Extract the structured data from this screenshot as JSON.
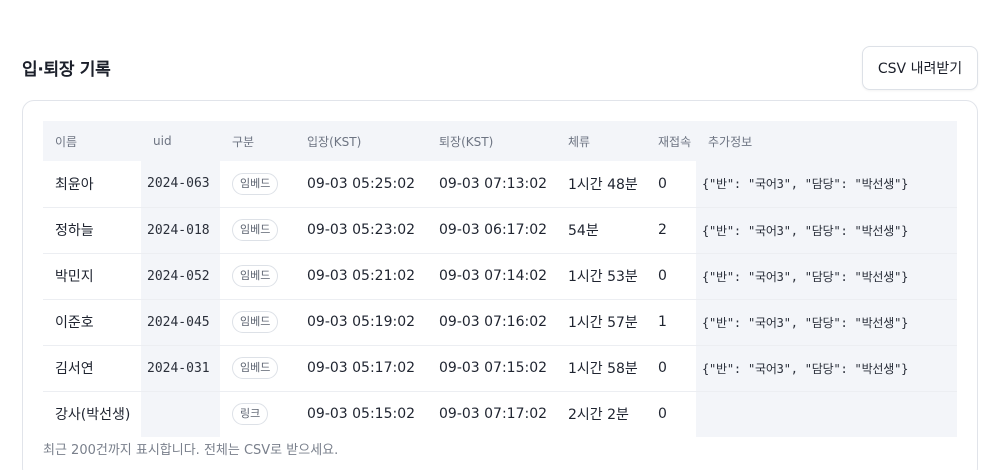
{
  "header": {
    "title": "입·퇴장 기록",
    "csv_button_label": "CSV 내려받기"
  },
  "table": {
    "columns": [
      "이름",
      "uid",
      "구분",
      "입장(KST)",
      "퇴장(KST)",
      "체류",
      "재접속",
      "추가정보"
    ],
    "rows": [
      {
        "name": "최윤아",
        "uid": "2024-063",
        "type": "임베드",
        "enter": "09-03 05:25:02",
        "exit": "09-03 07:13:02",
        "stay": "1시간 48분",
        "reconnect": "0",
        "extra": "{\"반\": \"국어3\", \"담당\": \"박선생\"}"
      },
      {
        "name": "정하늘",
        "uid": "2024-018",
        "type": "임베드",
        "enter": "09-03 05:23:02",
        "exit": "09-03 06:17:02",
        "stay": "54분",
        "reconnect": "2",
        "extra": "{\"반\": \"국어3\", \"담당\": \"박선생\"}"
      },
      {
        "name": "박민지",
        "uid": "2024-052",
        "type": "임베드",
        "enter": "09-03 05:21:02",
        "exit": "09-03 07:14:02",
        "stay": "1시간 53분",
        "reconnect": "0",
        "extra": "{\"반\": \"국어3\", \"담당\": \"박선생\"}"
      },
      {
        "name": "이준호",
        "uid": "2024-045",
        "type": "임베드",
        "enter": "09-03 05:19:02",
        "exit": "09-03 07:16:02",
        "stay": "1시간 57분",
        "reconnect": "1",
        "extra": "{\"반\": \"국어3\", \"담당\": \"박선생\"}"
      },
      {
        "name": "김서연",
        "uid": "2024-031",
        "type": "임베드",
        "enter": "09-03 05:17:02",
        "exit": "09-03 07:15:02",
        "stay": "1시간 58분",
        "reconnect": "0",
        "extra": "{\"반\": \"국어3\", \"담당\": \"박선생\"}"
      },
      {
        "name": "강사(박선생)",
        "uid": "",
        "type": "링크",
        "enter": "09-03 05:15:02",
        "exit": "09-03 07:17:02",
        "stay": "2시간 2분",
        "reconnect": "0",
        "extra": ""
      }
    ]
  },
  "footnote": "최근 200건까지 표시합니다. 전체는 CSV로 받으세요."
}
